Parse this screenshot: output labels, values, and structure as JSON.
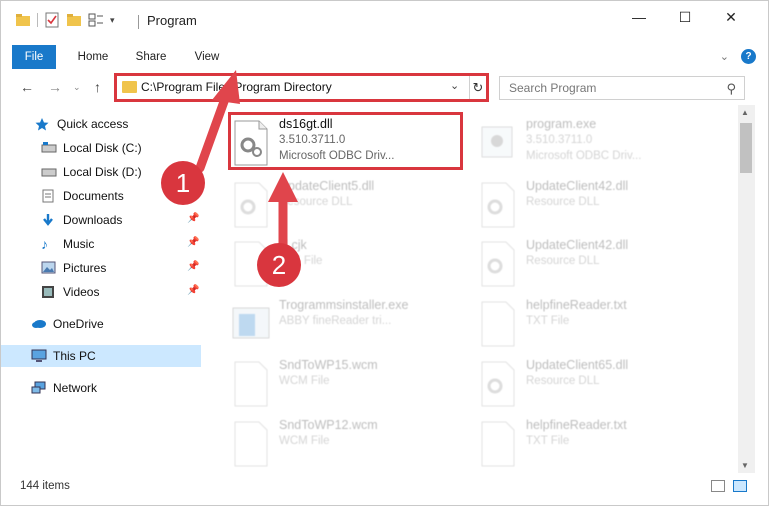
{
  "window": {
    "title": "Program",
    "controls": {
      "minimize": "—",
      "maximize": "☐",
      "close": "✕"
    }
  },
  "ribbon": {
    "tabs": [
      {
        "label": "File",
        "active": true
      },
      {
        "label": "Home"
      },
      {
        "label": "Share"
      },
      {
        "label": "View"
      }
    ],
    "expand_icon": "chevron-down-icon",
    "help_icon": "?"
  },
  "address_bar": {
    "path": "C:\\Program Files\\Program Directory",
    "dropdown_icon": "chevron-down-icon",
    "refresh_icon": "refresh-icon"
  },
  "search": {
    "placeholder": "Search Program"
  },
  "sidebar": {
    "items": [
      {
        "label": "Quick access",
        "icon": "star-icon",
        "indent": 0
      },
      {
        "label": "Local Disk (C:)",
        "icon": "drive-icon",
        "indent": 1
      },
      {
        "label": "Local Disk (D:)",
        "icon": "drive-icon",
        "indent": 1
      },
      {
        "label": "Documents",
        "icon": "documents-icon",
        "indent": 1
      },
      {
        "label": "Downloads",
        "icon": "downloads-icon",
        "indent": 1,
        "pinned": true
      },
      {
        "label": "Music",
        "icon": "music-icon",
        "indent": 1,
        "pinned": true
      },
      {
        "label": "Pictures",
        "icon": "pictures-icon",
        "indent": 1,
        "pinned": true
      },
      {
        "label": "Videos",
        "icon": "videos-icon",
        "indent": 1,
        "pinned": true
      },
      {
        "label": "OneDrive",
        "icon": "cloud-icon",
        "indent": 0
      },
      {
        "label": "This PC",
        "icon": "computer-icon",
        "indent": 0,
        "selected": true
      },
      {
        "label": "Network",
        "icon": "network-icon",
        "indent": 0
      }
    ]
  },
  "files": [
    {
      "name": "ds16gt.dll",
      "line2": "3.510.3711.0",
      "line3": "Microsoft ODBC Driv...",
      "highlighted": true
    },
    {
      "name": "program.exe",
      "line2": "3.510.3711.0",
      "line3": "Microsoft ODBC Driv...",
      "faded": true
    },
    {
      "name": "UpdateClient5.dll",
      "line2": "Resource DLL",
      "faded": true
    },
    {
      "name": "UpdateClient42.dll",
      "line2": "Resource DLL",
      "faded": true
    },
    {
      "name": "zl.cjk",
      "line2": "CJK File",
      "faded": true
    },
    {
      "name": "UpdateClient42.dll",
      "line2": "Resource DLL",
      "faded": true
    },
    {
      "name": "Trogrammsinstaller.exe",
      "line2": "ABBY fineReader tri...",
      "faded": true
    },
    {
      "name": "helpfineReader.txt",
      "line2": "TXT File",
      "faded": true
    },
    {
      "name": "SndToWP15.wcm",
      "line2": "WCM File",
      "faded": true
    },
    {
      "name": "UpdateClient65.dll",
      "line2": "Resource DLL",
      "faded": true
    },
    {
      "name": "SndToWP12.wcm",
      "line2": "WCM File",
      "faded": true
    },
    {
      "name": "helpfineReader.txt",
      "line2": "TXT File",
      "faded": true
    }
  ],
  "status": {
    "count_text": "144 items"
  },
  "annotations": {
    "step1": "1",
    "step2": "2",
    "accent": "#d9363e"
  },
  "colors": {
    "accent": "#1979ca",
    "selected_bg": "#cce8ff",
    "folder": "#f0c44c"
  }
}
